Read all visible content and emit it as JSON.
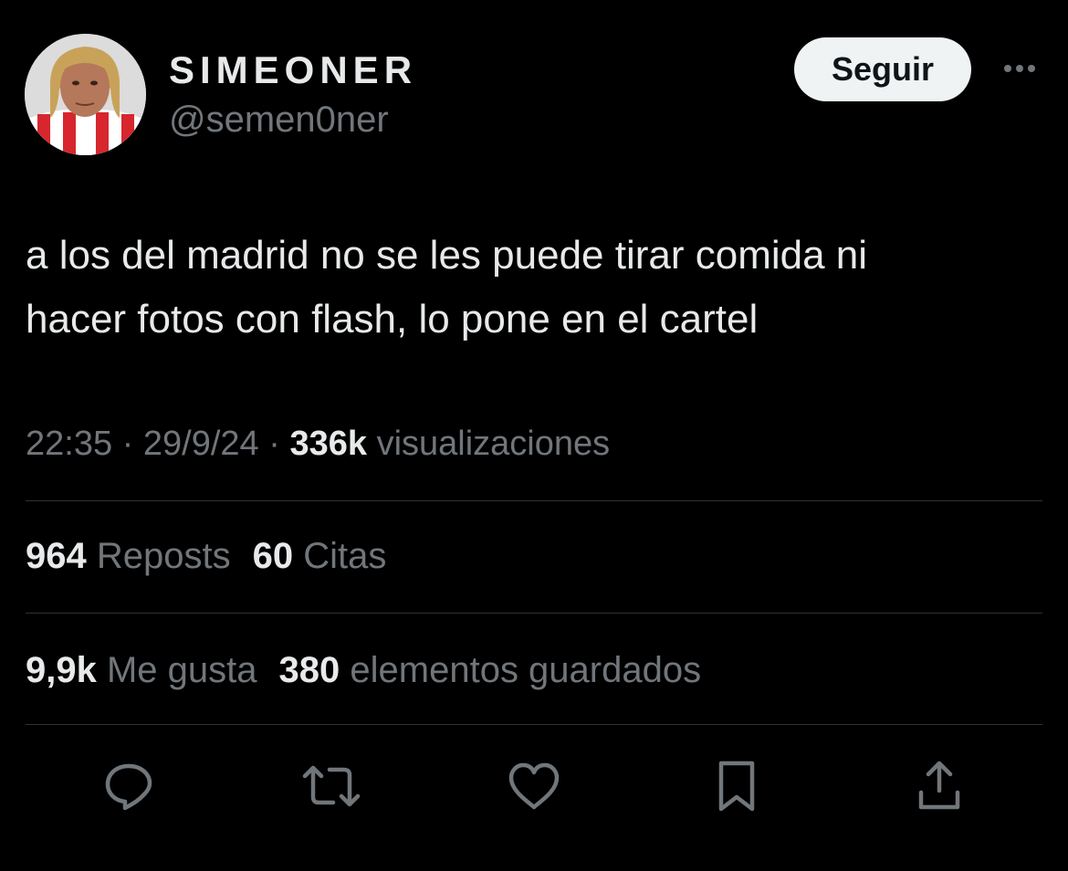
{
  "author": {
    "display_name": "SIMEONER",
    "handle": "@semen0ner",
    "avatar_icon": "profile-photo"
  },
  "follow_button": {
    "label": "Seguir"
  },
  "more_icon": "ellipsis-icon",
  "tweet": {
    "text_line1": "a los del madrid no se les puede tirar comida ni",
    "text_line2": "hacer fotos con flash, lo pone en el cartel"
  },
  "meta": {
    "time": "22:35",
    "separator": " · ",
    "date": "29/9/24",
    "views_count": "336k",
    "views_label": "visualizaciones"
  },
  "stats": {
    "reposts_count": "964",
    "reposts_label": "Reposts",
    "quotes_count": "60",
    "quotes_label": "Citas",
    "likes_count": "9,9k",
    "likes_label": "Me gusta",
    "bookmarks_count": "380",
    "bookmarks_label": "elementos guardados"
  },
  "actions": [
    "reply-icon",
    "retweet-icon",
    "like-icon",
    "bookmark-icon",
    "share-icon"
  ],
  "colors": {
    "background": "#000000",
    "primary_text": "#e7e9ea",
    "secondary_text": "#71767b",
    "divider": "#2f3336",
    "button_bg": "#eff3f4"
  }
}
